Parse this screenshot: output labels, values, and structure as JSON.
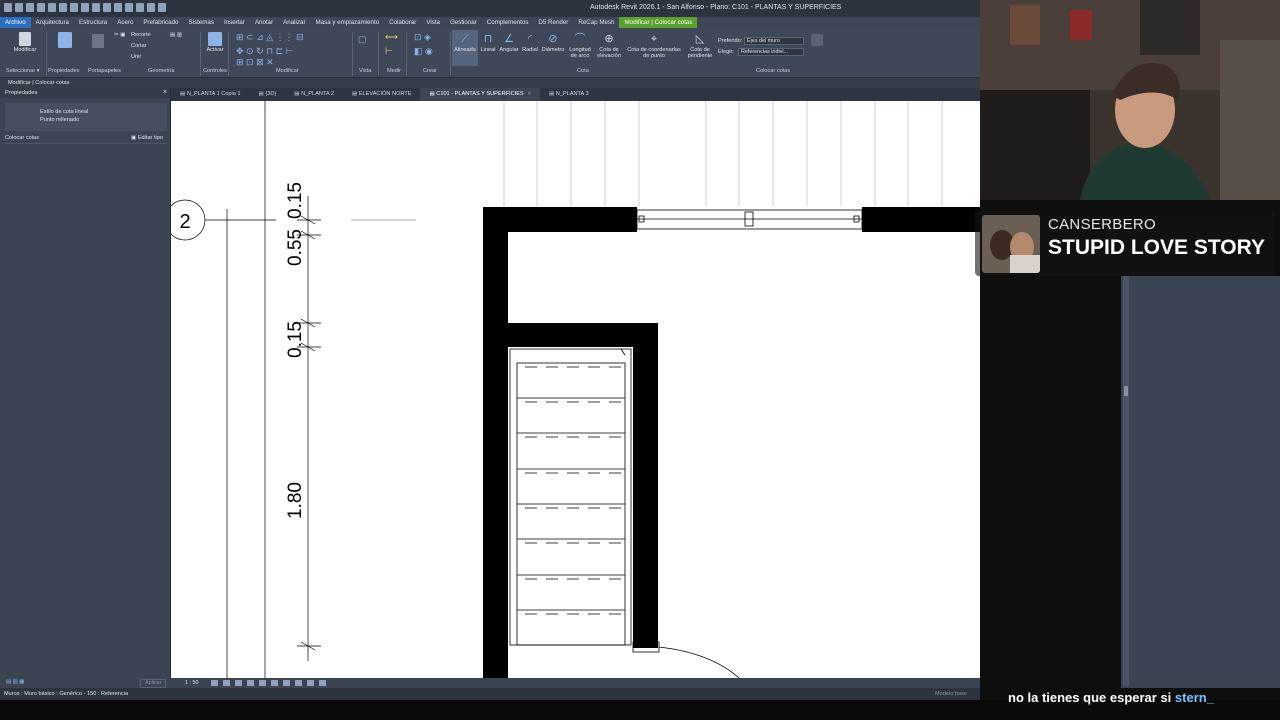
{
  "titlebar": {
    "window_title": "Autodesk Revit 2026.1 - San Alfonso - Plano: C101 - PLANTAS Y SUPERFICIES"
  },
  "menu": {
    "tabs": [
      "Archivo",
      "Arquitectura",
      "Estructura",
      "Acero",
      "Prefabricado",
      "Sistemas",
      "Insertar",
      "Anotar",
      "Analizar",
      "Masa y emplazamiento",
      "Colaborar",
      "Vista",
      "Gestionar",
      "Complementos",
      "D5 Render",
      "ReCap Mesh",
      "Modificar | Colocar cotas"
    ]
  },
  "ribbon": {
    "modificar": "Modificar",
    "recorte": "Recorte",
    "cortar": "Cortar",
    "unir": "Unir",
    "activar": "Activar",
    "alineada": "Alineada",
    "lineal": "Lineal",
    "angular": "Angular",
    "radial": "Radial",
    "diametro": "Diámetro",
    "longitud_arco": "Longitud de arco",
    "cota_elevacion": "Cota de elevación",
    "cota_coordenadas": "Cota de coordenadas de punto",
    "cota_pendiente": "Cota de pendiente",
    "preferido_label": "Preferido:",
    "preferido_value": "Ejes del muro",
    "elegir_label": "Elegir:",
    "elegir_value": "Referencias indivi...",
    "panels": {
      "seleccionar": "Seleccionar ▾",
      "propiedades": "Propiedades",
      "portapapeles": "Portapapeles",
      "geometria": "Geometría",
      "controles": "Controles",
      "modificar": "Modificar",
      "vista": "Vista",
      "medir": "Medir",
      "crear": "Crear",
      "cota": "Cota",
      "colocar_cotas": "Colocar cotas"
    }
  },
  "context_bar": "Modificar | Colocar cotas",
  "properties": {
    "header": "Propiedades",
    "type_line1": "Estilo de cota lineal",
    "type_line2": "Punto rellenado",
    "row_label": "Colocar cotas",
    "edit_type": "Editar tipo",
    "apply": "Aplicar"
  },
  "doc_tabs": [
    "N_PLANTA 1 Copia 1",
    "{3D}",
    "N_PLANTA 2",
    "ELEVACIÓN NORTE",
    "C101 - PLANTAS Y SUPERFICIES",
    "N_PLANTA 3"
  ],
  "active_doc_tab": "C101 - PLANTAS Y SUPERFICIES",
  "drawing": {
    "grid_bubble": "2",
    "dims": [
      "0.15",
      "0.55",
      "0.15",
      "1.80"
    ]
  },
  "viewbar": {
    "scale": "1 : 50"
  },
  "statusbar": {
    "text": "Muros : Muro básico : Genérico - 150 : Referencia",
    "model": "Modelo base"
  },
  "song": {
    "artist": "CANSERBERO",
    "title": "STUPID LOVE STORY"
  },
  "subtitle": {
    "text": "no la tienes que esperar si",
    "user": "stern_"
  },
  "colors": {
    "accent_file": "#2a6fbf",
    "accent_context": "#5aa02c",
    "ui_bg": "#3b4453"
  }
}
